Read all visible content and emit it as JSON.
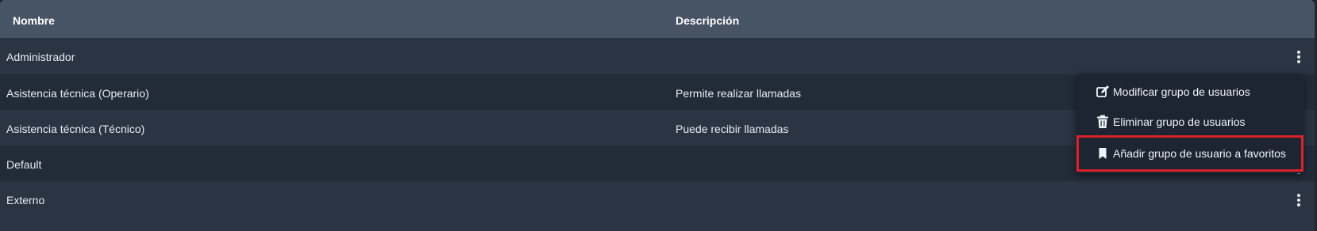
{
  "table": {
    "headers": {
      "name": "Nombre",
      "description": "Descripción"
    },
    "rows": [
      {
        "name": "Administrador",
        "description": ""
      },
      {
        "name": "Asistencia técnica (Operario)",
        "description": "Permite realizar llamadas"
      },
      {
        "name": "Asistencia técnica (Técnico)",
        "description": "Puede recibir llamadas"
      },
      {
        "name": "Default",
        "description": ""
      },
      {
        "name": "Externo",
        "description": ""
      }
    ]
  },
  "context_menu": {
    "items": [
      {
        "label": "Modificar grupo de usuarios",
        "icon": "edit-icon"
      },
      {
        "label": "Eliminar grupo de usuarios",
        "icon": "trash-icon"
      },
      {
        "label": "Añadir grupo de usuario a favoritos",
        "icon": "bookmark-icon"
      }
    ],
    "highlighted_index": 2
  },
  "colors": {
    "header_bg": "#475466",
    "row_odd": "#2a3443",
    "row_even": "#222c39",
    "menu_bg": "#1d2532",
    "highlight": "#d9232a"
  }
}
